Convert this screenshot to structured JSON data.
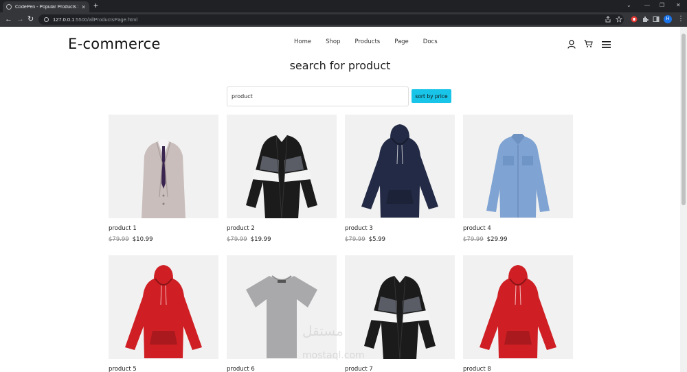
{
  "browser": {
    "tab_title": "CodePen - Popular Products Sec",
    "url_host": "127.0.0.1",
    "url_path": ":5500/allProductsPage.html",
    "profile_initial": "H"
  },
  "header": {
    "logo": "E-commerce",
    "nav": [
      "Home",
      "Shop",
      "Products",
      "Page",
      "Docs"
    ]
  },
  "main": {
    "heading": "search for product",
    "search_value": "product",
    "sort_label": "sort by price"
  },
  "products": [
    {
      "name": "product 1",
      "old_price": "$79.99",
      "price": "$10.99",
      "image": "suit-icon",
      "color": "#c9bebb"
    },
    {
      "name": "product 2",
      "old_price": "$79.99",
      "price": "$19.99",
      "image": "cardigan-icon",
      "color": "#1b1b1b"
    },
    {
      "name": "product 3",
      "old_price": "$79.99",
      "price": "$5.99",
      "image": "hoodie-icon",
      "color": "#232a45"
    },
    {
      "name": "product 4",
      "old_price": "$79.99",
      "price": "$29.99",
      "image": "shirt-icon",
      "color": "#7fa3d2"
    },
    {
      "name": "product 5",
      "old_price": "",
      "price": "",
      "image": "hoodie-icon",
      "color": "#cf1f24"
    },
    {
      "name": "product 6",
      "old_price": "",
      "price": "",
      "image": "tshirt-icon",
      "color": "#a9a9ab"
    },
    {
      "name": "product 7",
      "old_price": "",
      "price": "",
      "image": "cardigan-icon",
      "color": "#1b1b1b"
    },
    {
      "name": "product 8",
      "old_price": "",
      "price": "",
      "image": "hoodie-icon",
      "color": "#cf1f24"
    }
  ],
  "watermark": "مستقل",
  "watermark_sub": "mostaql.com"
}
